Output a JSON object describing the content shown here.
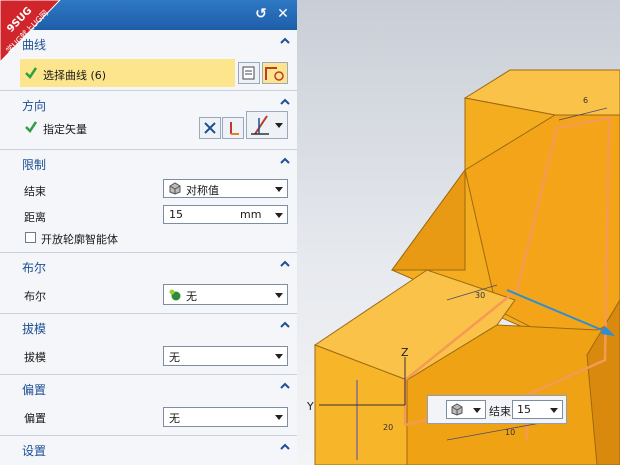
{
  "watermark": {
    "line1": "9SUG",
    "line2": "学UG就上UG网"
  },
  "sections": {
    "curve": {
      "title": "曲线",
      "select_label": "选择曲线 (6)"
    },
    "direction": {
      "title": "方向",
      "vector_label": "指定矢量"
    },
    "limits": {
      "title": "限制",
      "end_label": "结束",
      "end_value": "对称值",
      "distance_label": "距离",
      "distance_value": "15",
      "distance_unit": "mm",
      "open_profile_label": "开放轮廓智能体"
    },
    "boolean": {
      "title": "布尔",
      "boolean_label": "布尔",
      "boolean_value": "无"
    },
    "draft": {
      "title": "拔模",
      "draft_label": "拔模",
      "draft_value": "无"
    },
    "offset": {
      "title": "偏置",
      "offset_label": "偏置",
      "offset_value": "无"
    },
    "settings": {
      "title": "设置"
    }
  },
  "float_toolbar": {
    "label": "结束",
    "value": "15"
  },
  "viewport": {
    "dim_labels": [
      "6",
      "30",
      "20",
      "10"
    ],
    "axis_labels": [
      "Z",
      "Y"
    ]
  },
  "colors": {
    "title_bar": "#1e5ea9",
    "section_title": "#1c4f95",
    "highlight": "#fde58d",
    "solid_face": "#f5ad20",
    "solid_light": "#fbc24a",
    "solid_dark": "#d8890e",
    "sketch": "#f59a52",
    "vector": "#2a8fd6"
  }
}
